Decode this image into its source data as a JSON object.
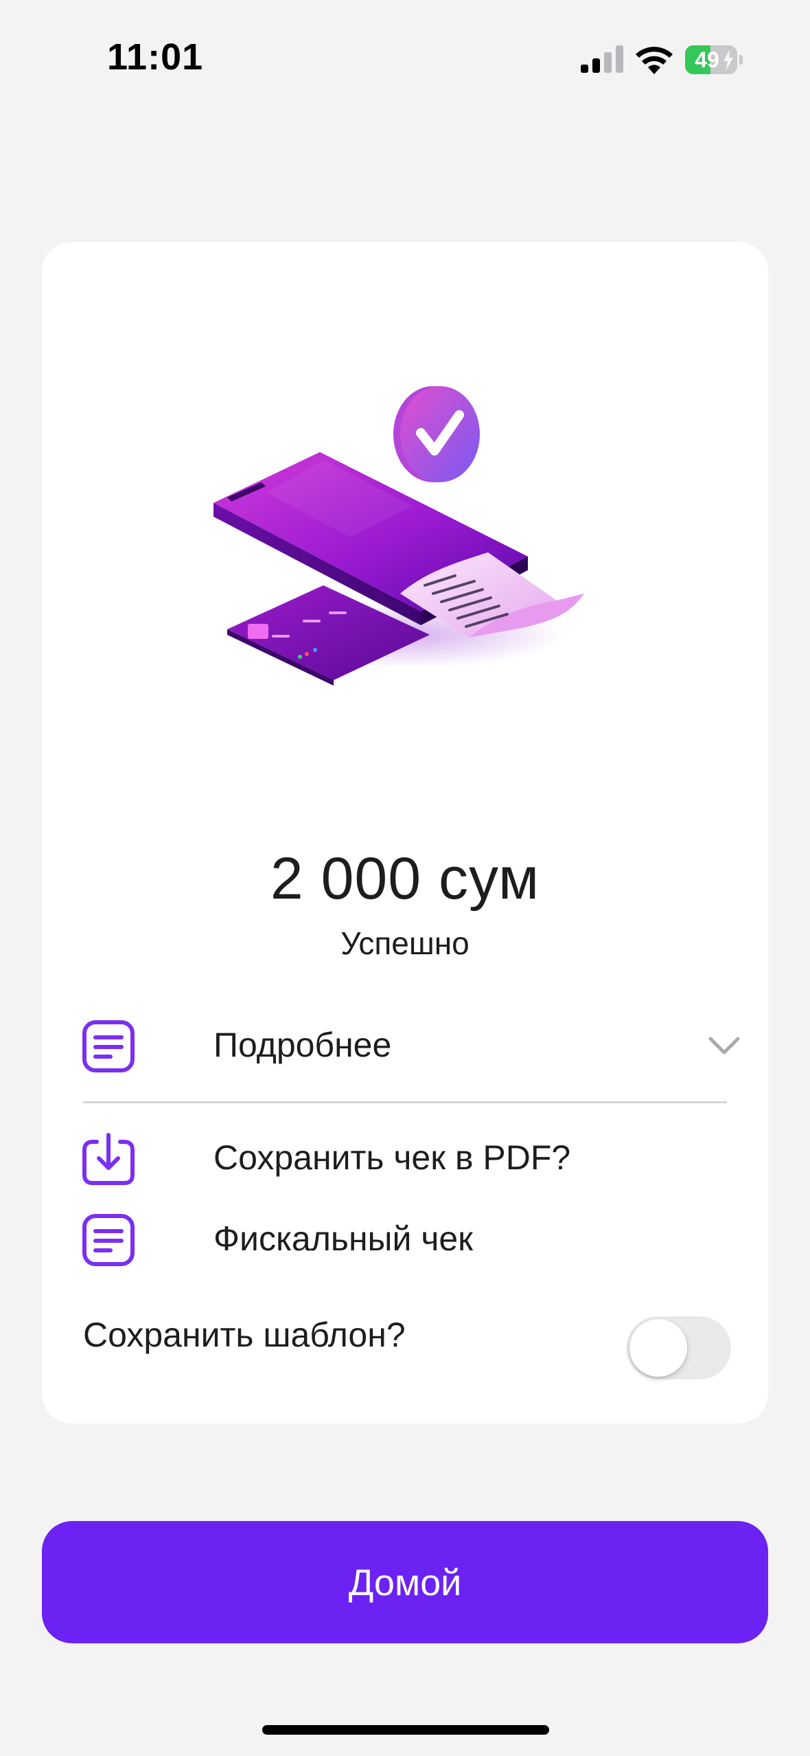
{
  "status_bar": {
    "time": "11:01",
    "battery_level": "49",
    "battery_fraction": 0.49,
    "battery_charging": true,
    "icons": [
      "cellular-signal-icon",
      "wifi-icon",
      "battery-icon"
    ]
  },
  "receipt": {
    "amount": "2 000 сум",
    "status": "Успешно",
    "details_label": "Подробнее",
    "save_pdf_label": "Сохранить чек в PDF?",
    "fiscal_label": "Фискальный чек",
    "save_template_label": "Сохранить шаблон?",
    "save_template_enabled": false
  },
  "home_button": {
    "label": "Домой"
  },
  "colors": {
    "accent": "#6c22f2",
    "icon_purple": "#7b2ff0",
    "background": "#f3f3f4",
    "card": "#ffffff",
    "battery_green": "#34c759"
  }
}
